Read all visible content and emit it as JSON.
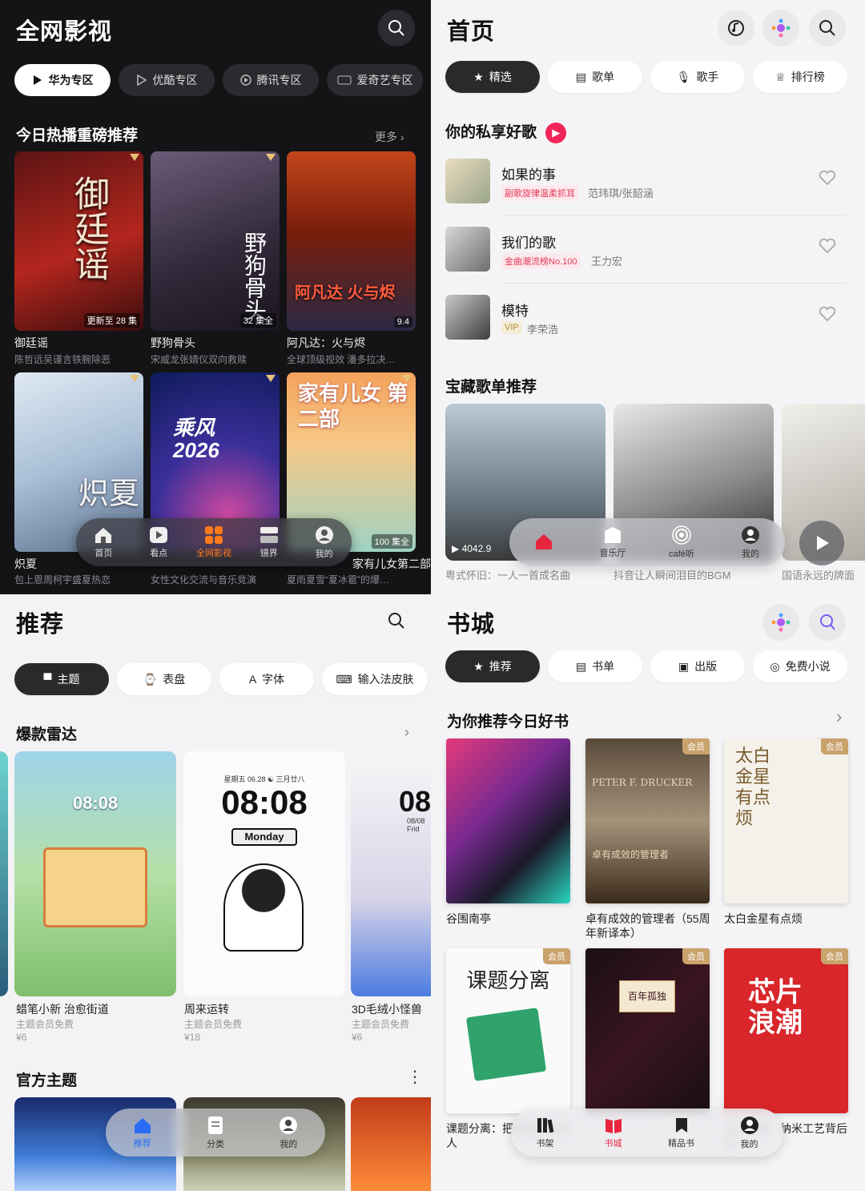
{
  "video": {
    "title": "全网影视",
    "tabs": [
      "华为专区",
      "优酷专区",
      "腾讯专区",
      "爱奇艺专区"
    ],
    "section": "今日热播重磅推荐",
    "more": "更多",
    "posters": [
      {
        "title": "御廷谣",
        "sub": "陈哲远吴谨言铁腕除恶",
        "badge": "更新至 28 集",
        "art": "御廷谣"
      },
      {
        "title": "野狗骨头",
        "sub": "宋威龙张婧仪双向救赎",
        "badge": "32 集全",
        "art": "野狗骨头"
      },
      {
        "title": "阿凡达：火与烬",
        "sub": "全球顶级视效 潘多拉决…",
        "badge": "9.4",
        "art": "阿凡达 火与烬"
      },
      {
        "title": "炽夏",
        "sub": "包上恩周柯宇盛夏热恋",
        "badge": "",
        "art": "炽夏"
      },
      {
        "title": "",
        "sub": "女性文化交流与音乐竞演",
        "badge": "",
        "art": "乘风 2026"
      },
      {
        "title": "家有儿女第二部",
        "sub": "夏雨夏雪“夏冰雹”的爆…",
        "badge": "100 集全",
        "art": "家有儿女 第二部"
      }
    ],
    "nav": [
      "首页",
      "看点",
      "全网影视",
      "镜界",
      "我的"
    ]
  },
  "music": {
    "title": "首页",
    "tabs": [
      "精选",
      "歌单",
      "歌手",
      "排行榜"
    ],
    "section1": "你的私享好歌",
    "songs": [
      {
        "name": "如果的事",
        "tag": "副歌旋律温柔抓耳",
        "artist": "范玮琪/张韶涵"
      },
      {
        "name": "我们的歌",
        "tag": "金曲潮流榜No.100",
        "artist": "王力宏"
      },
      {
        "name": "模特",
        "tag": "VIP",
        "artist": "李荣浩"
      }
    ],
    "section2": "宝藏歌单推荐",
    "playlists": [
      {
        "cap": "粤式怀旧：一人一首成名曲",
        "count": "4042.9"
      },
      {
        "cap": "抖音让人瞬间泪目的BGM",
        "count": ""
      },
      {
        "cap": "国语永远的牌面",
        "count": ""
      }
    ],
    "nav": [
      "",
      "音乐厅",
      "café听",
      "我的"
    ]
  },
  "theme": {
    "title": "推荐",
    "tabs": [
      "主题",
      "表盘",
      "字体",
      "输入法皮肤"
    ],
    "section1": "爆款雷达",
    "cards": [
      {
        "name": "蜡笔小新 治愈街道",
        "sub": "主题会员免费",
        "price": "¥6",
        "clock": "08:08"
      },
      {
        "name": "周来运转",
        "sub": "主题会员免费",
        "price": "¥18",
        "clock": "08:08",
        "date": "星期五 06.28 ☯ 三月廿八",
        "day": "Monday"
      },
      {
        "name": "3D毛绒小怪兽",
        "sub": "主题会员免费",
        "price": "¥6",
        "clock": "08",
        "date": "08/08 Frid"
      }
    ],
    "section2": "官方主题",
    "nav": [
      "推荐",
      "分类",
      "我的"
    ]
  },
  "book": {
    "title": "书城",
    "tabs": [
      "推荐",
      "书单",
      "出版",
      "免费小说"
    ],
    "section": "为你推荐今日好书",
    "vip": "会员",
    "books": [
      {
        "name": "谷围南亭",
        "art": ""
      },
      {
        "name": "卓有成效的管理者（55周年新译本）",
        "art": "PETER F. DRUCKER 卓有成效的管理者"
      },
      {
        "name": "太白金星有点烦",
        "art": "太白金星有点烦"
      },
      {
        "name": "课题分离：把课题还给别人",
        "art": "课题分离"
      },
      {
        "name": "",
        "art": "百年孤独"
      },
      {
        "name": "芯片浪潮：纳米工艺背后的…",
        "art": "芯片浪潮"
      }
    ],
    "nav": [
      "书架",
      "书城",
      "精品书",
      "我的"
    ]
  }
}
